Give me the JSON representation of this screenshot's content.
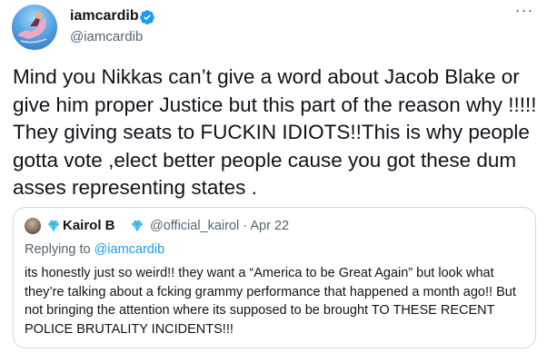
{
  "tweet": {
    "author_name": "iamcardib",
    "author_handle": "@iamcardib",
    "text": "Mind you Nikkas can’t give a word about Jacob Blake or give him proper Justice but this part of the reason why !!!!! They giving seats to FUCKIN IDIOTS!!This is why people gotta vote ,elect better people cause you got these dum asses representing states .",
    "more_icon": "more-icon"
  },
  "quote": {
    "author_name": "Kairol B",
    "handle_and_date": "@official_kairol · Apr 22",
    "replying_prefix": "Replying to ",
    "replying_mention": "@iamcardib",
    "text": "its honestly just so weird!! they want a “America to be Great Again” but look what they’re talking about a fcking grammy performance that happened a month ago!! But not bringing the attention where its supposed to be brought TO THESE RECENT POLICE BRUTALITY INCIDENTS!!!"
  },
  "colors": {
    "verified": "#1d9bf0",
    "secondary_text": "#536471",
    "mention": "#1d9bf0",
    "border": "#cfd9de"
  }
}
